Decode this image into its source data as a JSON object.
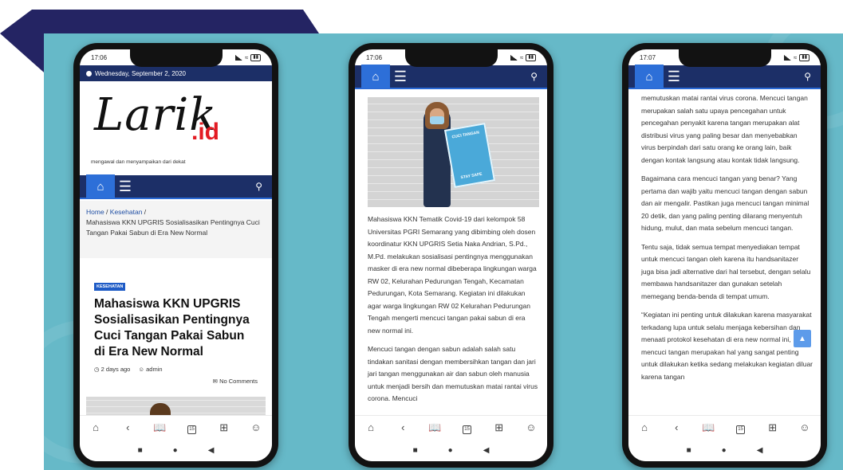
{
  "colors": {
    "backdrop": "#66b9c8",
    "banner": "#242463",
    "navbar": "#1c2f67",
    "accent": "#2d6fd8",
    "logo_red": "#e31b23"
  },
  "icons": {
    "home": "home-icon",
    "menu": "hamburger-menu-icon",
    "search": "search-icon"
  },
  "phones": [
    {
      "status_time": "17:06",
      "date": "Wednesday, September 2, 2020",
      "logo": {
        "text": "Larik",
        "suffix": ".id",
        "tagline": "mengawal dan menyampaikan dari dekat"
      },
      "breadcrumb": {
        "home": "Home",
        "sep": " / ",
        "category": "Kesehatan",
        "sep2": " /",
        "current": "Mahasiswa KKN UPGRIS Sosialisasikan Pentingnya Cuci Tangan Pakai Sabun di Era New Normal"
      },
      "article": {
        "category": "KESEHATAN",
        "title": "Mahasiswa KKN UPGRIS Sosialisasikan Pentingnya Cuci Tangan Pakai Sabun di Era New Normal",
        "time_ago": "2 days ago",
        "author": "admin",
        "comments": "No Comments"
      }
    },
    {
      "status_time": "17:06",
      "photo": {
        "poster_title": "CUCI TANGAN",
        "poster_foot": "STAY SAFE"
      },
      "paragraphs": [
        "Mahasiswa KKN Tematik Covid-19 dari kelompok 58 Universitas PGRI Semarang yang dibimbing oleh dosen koordinatur KKN UPGRIS Setia Naka Andrian, S.Pd., M.Pd. melakukan sosialisasi pentingnya menggunakan masker di era new normal dibeberapa lingkungan warga RW 02, Kelurahan Pedurungan Tengah, Kecamatan Pedurungan, Kota Semarang. Kegiatan ini dilakukan agar warga lingkungan RW 02 Kelurahan Pedurungan Tengah mengerti mencuci tangan pakai sabun di era new normal ini.",
        "Mencuci tangan dengan sabun adalah salah satu tindakan sanitasi dengan membersihkan tangan dan jari jari tangan menggunakan air dan sabun oleh manusia untuk menjadi bersih dan memutuskan matai rantai virus corona. Mencuci"
      ]
    },
    {
      "status_time": "17:07",
      "paragraphs": [
        "memutuskan matai rantai virus corona. Mencuci tangan merupakan salah satu upaya pencegahan untuk pencegahan penyakit karena tangan merupakan alat distribusi virus yang paling besar dan menyebabkan virus berpindah dari satu orang ke orang lain, baik dengan kontak langsung atau kontak tidak langsung.",
        "Bagaimana cara mencuci tangan yang benar? Yang pertama dan wajib yaitu mencuci tangan dengan sabun dan air mengalir. Pastikan juga mencuci tangan minimal 20 detik, dan yang paling penting dilarang menyentuh hidung, mulut, dan mata sebelum mencuci tangan.",
        "Tentu saja, tidak semua tempat menyediakan tempat untuk mencuci tangan oleh karena itu handsanitazer juga bisa jadi alternative dari hal tersebut, dengan selalu membawa handsanitazer dan gunakan setelah memegang benda-benda di tempat umum.",
        "“Kegiatan ini penting untuk dilakukan karena masyarakat terkadang lupa untuk selalu menjaga kebersihan dan menaati protokol kesehatan di era new normal ini, mencuci tangan merupakan hal yang sangat penting untuk dilakukan ketika sedang melakukan kegiatan diluar karena tangan"
      ]
    }
  ],
  "bottom_nav_tabs_count": "15"
}
